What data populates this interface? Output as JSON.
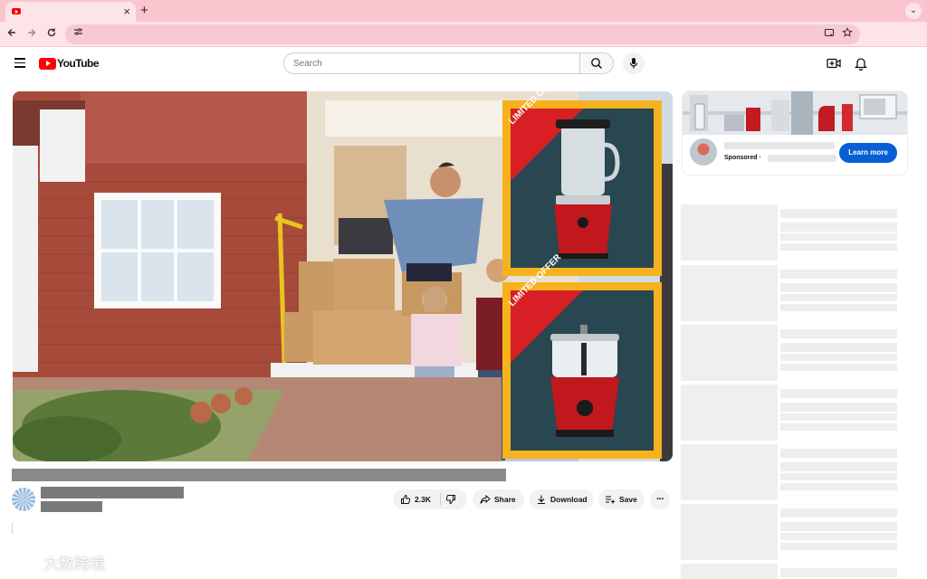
{
  "browser": {
    "tab_close": "×",
    "new_tab": "+",
    "tab_menu": "⌄"
  },
  "youtube": {
    "logo_text": "YouTube",
    "search_placeholder": "Search"
  },
  "video": {
    "ad_overlay_badge_1": "LIMITED OFFER",
    "ad_overlay_badge_2": "LIMITED OFFER"
  },
  "actions": {
    "like_count": "2.3K",
    "share_label": "Share",
    "download_label": "Download",
    "save_label": "Save",
    "more_label": "···"
  },
  "ad": {
    "sponsored_label": "Sponsored ·",
    "cta_label": "Learn more"
  },
  "watermark": {
    "text": "大数跨境"
  },
  "colors": {
    "chrome_tabbar": "#f9c5cf",
    "chrome_toolbar": "#fde4e9",
    "youtube_red": "#ff0000",
    "cta_blue": "#065fd4",
    "offer_frame": "#f6b21c",
    "offer_panel": "#294750",
    "badge_red": "#d81f26"
  }
}
